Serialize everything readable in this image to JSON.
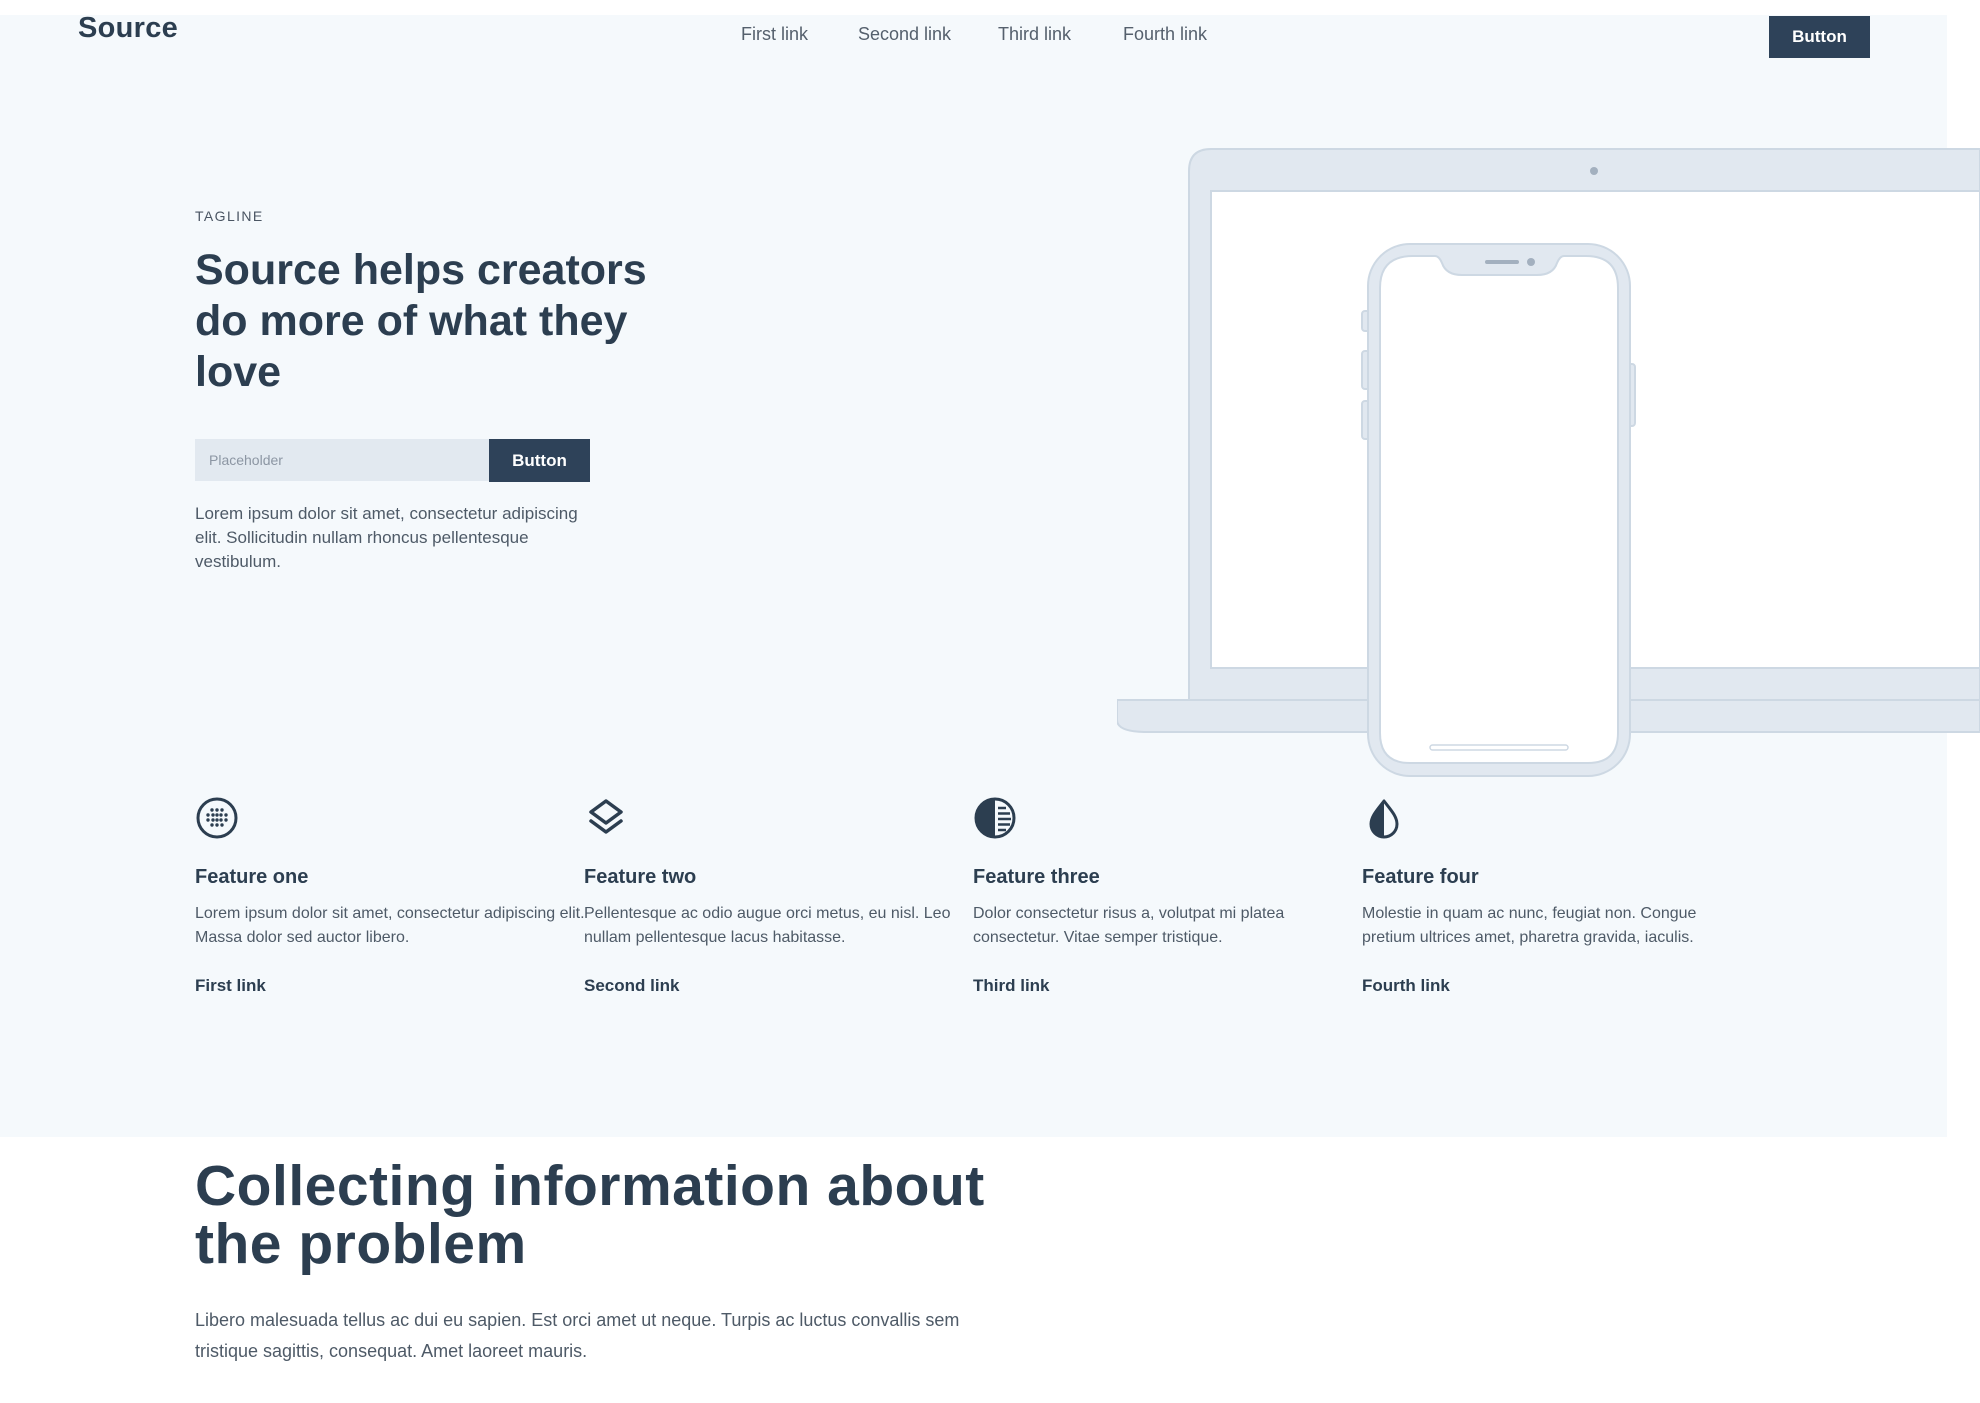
{
  "header": {
    "logo": "Source",
    "nav": [
      "First link",
      "Second link",
      "Third link",
      "Fourth link"
    ],
    "button_label": "Button"
  },
  "hero": {
    "tagline": "TAGLINE",
    "headline": "Source helps creators do more of what they love",
    "input_placeholder": "Placeholder",
    "button_label": "Button",
    "description": "Lorem ipsum dolor sit amet, consectetur adipiscing elit. Sollicitudin nullam rhoncus pellentesque vestibulum."
  },
  "features": [
    {
      "icon": "globe-icon",
      "title": "Feature one",
      "description": "Lorem ipsum dolor sit amet, consectetur adipiscing elit. Massa dolor sed auctor libero.",
      "link": "First link"
    },
    {
      "icon": "layers-icon",
      "title": "Feature two",
      "description": "Pellentesque ac odio augue orci metus, eu nisl. Leo nullam pellentesque lacus habitasse.",
      "link": "Second link"
    },
    {
      "icon": "half-circle-icon",
      "title": "Feature three",
      "description": "Dolor consectetur risus a, volutpat mi platea consectetur. Vitae semper tristique.",
      "link": "Third link"
    },
    {
      "icon": "drop-icon",
      "title": "Feature four",
      "description": "Molestie in quam ac nunc, feugiat non. Congue pretium ultrices amet, pharetra gravida, iaculis.",
      "link": "Fourth link"
    }
  ],
  "section": {
    "title": "Collecting information about the problem",
    "description": "Libero malesuada tellus ac dui eu sapien. Est orci amet ut neque. Turpis ac luctus convallis sem tristique sagittis, consequat. Amet laoreet mauris."
  },
  "colors": {
    "primary": "#2e4259",
    "text": "#2c3e50",
    "hero_background": "#f5f9fc",
    "device_frame": "#e1e8f0",
    "device_stroke": "#cdd8e3"
  }
}
